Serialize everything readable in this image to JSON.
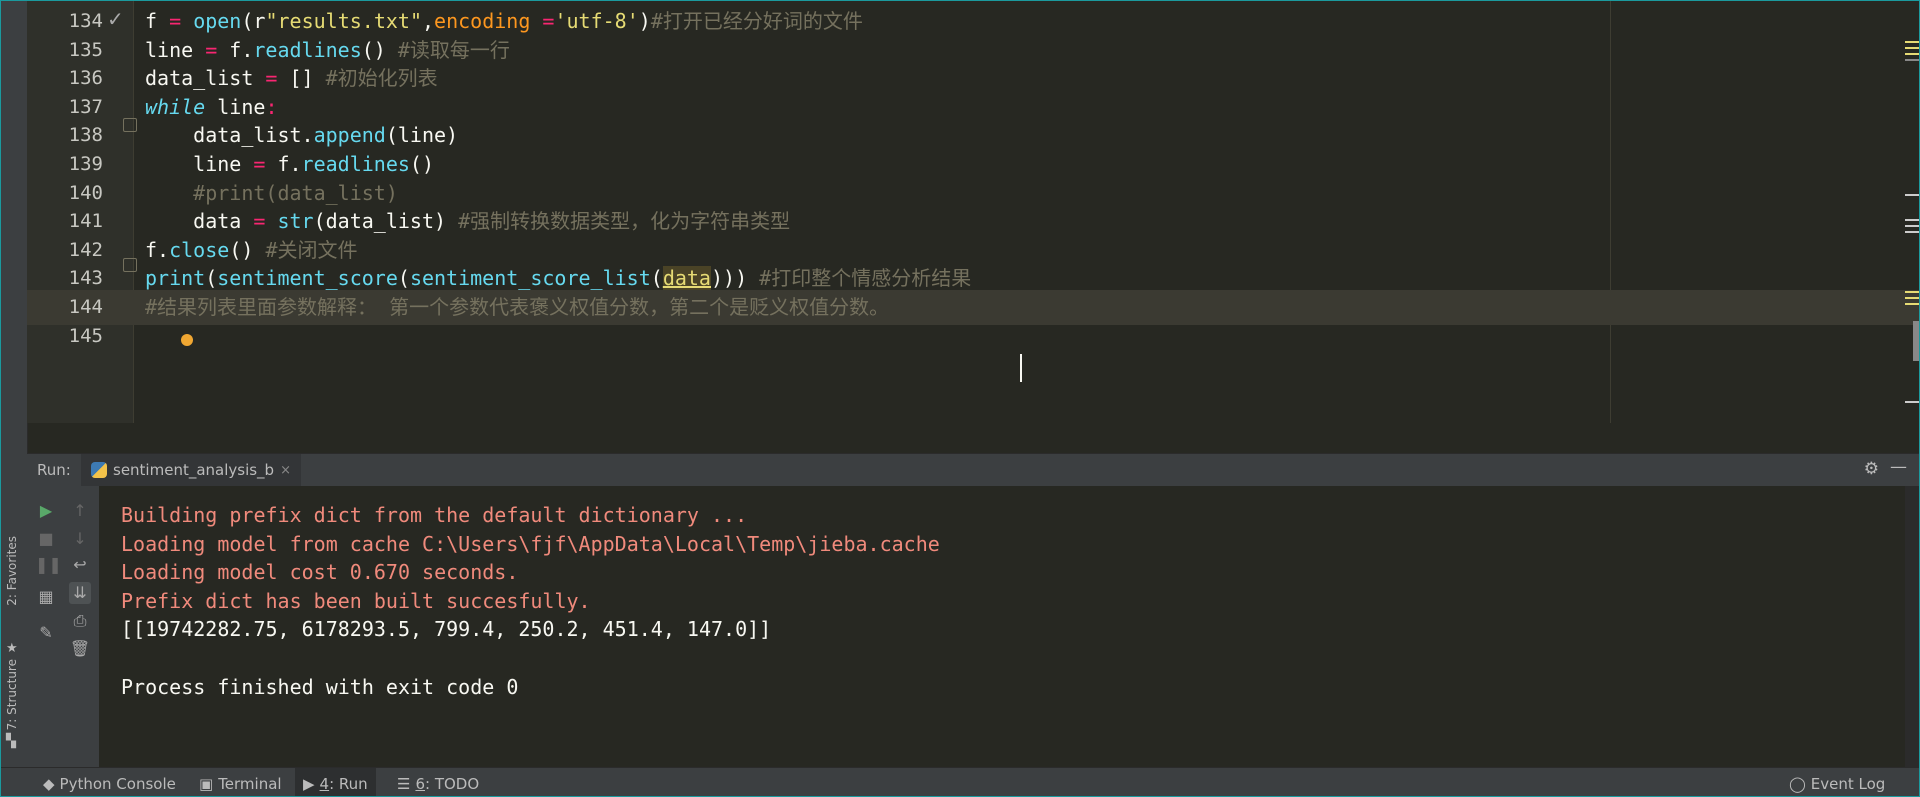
{
  "left_strip": {
    "favorites_label": "2: Favorites",
    "structure_label": "7: Structure"
  },
  "editor": {
    "lines": [
      {
        "number": "134",
        "tokens": [
          [
            "",
            "f "
          ],
          [
            "op",
            "="
          ],
          [
            "",
            " "
          ],
          [
            "fn",
            "open"
          ],
          [
            "",
            "(r"
          ],
          [
            "str",
            "\"results.txt\""
          ],
          [
            "",
            ","
          ],
          [
            "prm",
            "encoding "
          ],
          [
            "op",
            "="
          ],
          [
            "str",
            "'utf-8'"
          ],
          [
            "",
            ")"
          ],
          [
            "cmt",
            "#打开已经分好词的文件"
          ]
        ]
      },
      {
        "number": "135",
        "tokens": [
          [
            "",
            "line "
          ],
          [
            "op",
            "="
          ],
          [
            "",
            " f."
          ],
          [
            "fn",
            "readlines"
          ],
          [
            "",
            "() "
          ],
          [
            "cmt",
            "#读取每一行"
          ]
        ]
      },
      {
        "number": "136",
        "tokens": [
          [
            "",
            "data_list "
          ],
          [
            "op",
            "="
          ],
          [
            "",
            " [] "
          ],
          [
            "cmt",
            "#初始化列表"
          ]
        ]
      },
      {
        "number": "137",
        "tokens": [
          [
            "kw",
            "while"
          ],
          [
            "",
            " line"
          ],
          [
            "op",
            ":"
          ]
        ]
      },
      {
        "number": "138",
        "tokens": [
          [
            "",
            "    data_list."
          ],
          [
            "fn",
            "append"
          ],
          [
            "",
            "(line)"
          ]
        ]
      },
      {
        "number": "139",
        "tokens": [
          [
            "",
            "    line "
          ],
          [
            "op",
            "="
          ],
          [
            "",
            " f."
          ],
          [
            "fn",
            "readlines"
          ],
          [
            "",
            "()"
          ]
        ]
      },
      {
        "number": "140",
        "tokens": [
          [
            "cmt",
            "    #print(data_list)"
          ]
        ]
      },
      {
        "number": "141",
        "tokens": [
          [
            "",
            "    data "
          ],
          [
            "op",
            "="
          ],
          [
            "",
            " "
          ],
          [
            "fn",
            "str"
          ],
          [
            "",
            "(data_list) "
          ],
          [
            "cmt",
            "#强制转换数据类型，化为字符串类型"
          ]
        ]
      },
      {
        "number": "142",
        "tokens": [
          [
            "",
            "f."
          ],
          [
            "fn",
            "close"
          ],
          [
            "",
            "() "
          ],
          [
            "cmt",
            "#关闭文件"
          ]
        ]
      },
      {
        "number": "143",
        "tokens": [
          [
            "fn",
            "print"
          ],
          [
            "",
            "("
          ],
          [
            "fn",
            "sentiment_score"
          ],
          [
            "",
            "("
          ],
          [
            "fn",
            "sentiment_score_list"
          ],
          [
            "",
            "("
          ],
          [
            "hl",
            "data"
          ],
          [
            "",
            ")))"
          ],
          [
            "",
            " "
          ],
          [
            "cmt",
            "#打印整个情感分析结果"
          ]
        ]
      },
      {
        "number": "144",
        "tokens": [
          [
            "cmt",
            "#结果列表里面参数解释： 第一个参数代表褒义权值分数，第二个是贬义权值分数。"
          ]
        ]
      },
      {
        "number": "145",
        "tokens": []
      }
    ]
  },
  "run_panel": {
    "label": "Run:",
    "tab_name": "sentiment_analysis_b",
    "tab_close": "×"
  },
  "console": {
    "lines": [
      {
        "kind": "err",
        "text": "Building prefix dict from the default dictionary ..."
      },
      {
        "kind": "err",
        "text": "Loading model from cache C:\\Users\\fjf\\AppData\\Local\\Temp\\jieba.cache"
      },
      {
        "kind": "err",
        "text": "Loading model cost 0.670 seconds."
      },
      {
        "kind": "err",
        "text": "Prefix dict has been built succesfully."
      },
      {
        "kind": "out",
        "text": "[[19742282.75, 6178293.5, 799.4, 250.2, 451.4, 147.0]]"
      },
      {
        "kind": "out",
        "text": ""
      },
      {
        "kind": "out",
        "text": "Process finished with exit code 0"
      }
    ]
  },
  "bottom_bar": {
    "python_console": "Python Console",
    "terminal": "Terminal",
    "run_prefix": "4",
    "run": ": Run",
    "todo_prefix": "6",
    "todo": ": TODO",
    "event_log": "Event Log"
  },
  "colors": {
    "background": "#272822",
    "comment": "#75715e",
    "keyword": "#66d9ef",
    "string": "#e6db74",
    "operator": "#f92672",
    "stderr": "#f08a7c"
  }
}
